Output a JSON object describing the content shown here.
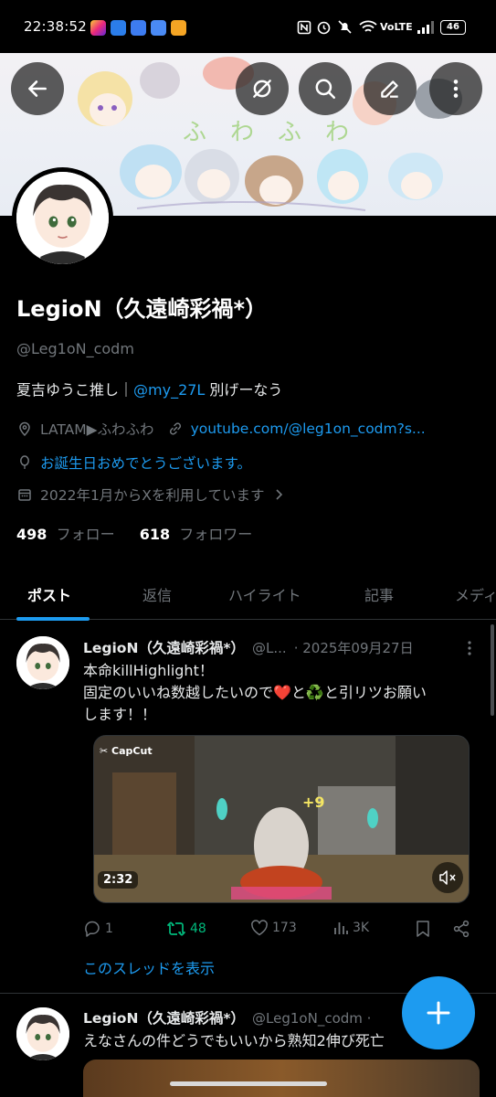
{
  "status_bar": {
    "time": "22:38:52",
    "network": "VoLTE",
    "battery": "46",
    "icons": [
      "nfc-icon",
      "alarm-icon",
      "mute-icon",
      "wifi-icon",
      "signal-icon"
    ]
  },
  "header": {
    "buttons": [
      "back-icon",
      "grok-icon",
      "search-icon",
      "edit-icon",
      "more-icon"
    ]
  },
  "profile": {
    "display_name": "LegioN（久遠崎彩禍*）",
    "handle": "@Leg1oN_codm",
    "bio_prefix": "夏吉ゆうこ推し｜",
    "bio_mention": "@my_27L",
    "bio_suffix": " 別げーなう",
    "location": "LATAM▶ふわふわ",
    "website": "youtube.com/@leg1on_codm?s...",
    "birthday": "お誕生日おめでとうございます。",
    "joined": "2022年1月からXを利用しています",
    "following_count": "498",
    "following_label": "フォロー",
    "followers_count": "618",
    "followers_label": "フォロワー"
  },
  "tabs": [
    "ポスト",
    "返信",
    "ハイライト",
    "記事",
    "メディ"
  ],
  "tweets": [
    {
      "name": "LegioN（久遠崎彩禍*）",
      "handle": "@L...",
      "date": "· 2025年09月27日",
      "text_line1": "本命killHighlight！",
      "text_line2": "固定のいいね数越したいので❤️と♻️と引リツお願い",
      "text_line3": "します！！",
      "media_brand": "CapCut",
      "media_duration": "2:32",
      "replies": "1",
      "reposts": "48",
      "likes": "173",
      "views": "3K",
      "show_thread": "このスレッドを表示"
    },
    {
      "name": "LegioN（久遠崎彩禍*）",
      "handle": "@Leg1oN_codm ·",
      "text_line1": "えなさんの件どうでもいいから熟知2伸び死亡"
    }
  ],
  "colors": {
    "accent": "#1d9bf0",
    "repost_active": "#00ba7c",
    "background": "#000000",
    "muted": "#71767b"
  }
}
